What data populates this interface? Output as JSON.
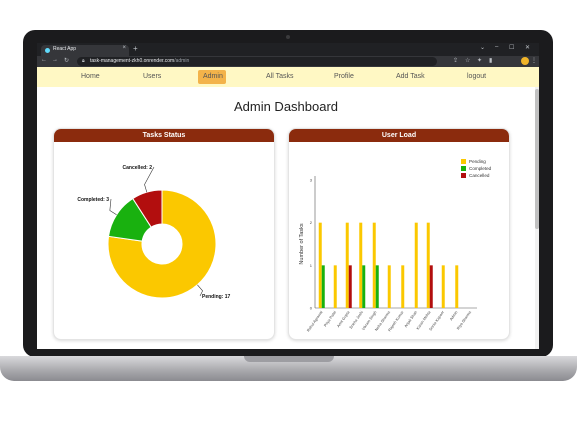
{
  "browser": {
    "tab_title": "React App",
    "tab_close": "×",
    "new_tab": "+",
    "url_host": "task-management-zkh0.onrender.com",
    "url_path": "/admin",
    "icons": [
      "back-arrow-icon",
      "forward-arrow-icon",
      "reload-icon",
      "lock-icon",
      "share-icon",
      "star-icon",
      "extensions-icon",
      "sidebar-icon",
      "profile-avatar",
      "menu-icon"
    ]
  },
  "nav": {
    "items": [
      {
        "label": "Home"
      },
      {
        "label": "Users"
      },
      {
        "label": "Admin",
        "active": true
      },
      {
        "label": "All Tasks"
      },
      {
        "label": "Profile"
      },
      {
        "label": "Add Task"
      },
      {
        "label": "logout"
      }
    ]
  },
  "page": {
    "title": "Admin Dashboard"
  },
  "colors": {
    "header": "#8b2b0d",
    "navbar": "#fff8c4",
    "pending": "#fbc800",
    "completed": "#19b10f",
    "cancelled": "#b20e0e"
  },
  "chart_data": [
    {
      "type": "pie",
      "title": "Tasks Status",
      "donut": true,
      "slices": [
        {
          "label": "Pending",
          "value": 17,
          "color": "#fbc800",
          "text": "Pending: 17"
        },
        {
          "label": "Completed",
          "value": 3,
          "color": "#19b10f",
          "text": "Completed: 3"
        },
        {
          "label": "Cancelled",
          "value": 2,
          "color": "#b20e0e",
          "text": "Cancelled: 2"
        }
      ]
    },
    {
      "type": "bar",
      "title": "User Load",
      "ylabel": "Number of Tasks",
      "ylim": [
        0,
        3
      ],
      "yticks": [
        "3",
        "2",
        "1",
        "0"
      ],
      "legend_position": "top-right",
      "categories": [
        "Rahul Agrawal",
        "Priya Patel",
        "Amit Gupta",
        "Sneha Joshi",
        "Vikram Singh",
        "Neha Sharma",
        "Rajesh Kumar",
        "Anjali Shah",
        "Karan Mehta",
        "Sonia Kapoor",
        "Admin",
        "Riya Sharma"
      ],
      "series": [
        {
          "name": "Pending",
          "color": "#fbc800",
          "values": [
            2,
            1,
            2,
            2,
            2,
            1,
            1,
            2,
            2,
            1,
            1,
            0
          ]
        },
        {
          "name": "Completed",
          "color": "#19b10f",
          "values": [
            1,
            0,
            0,
            1,
            1,
            0,
            0,
            0,
            0,
            0,
            0,
            0
          ]
        },
        {
          "name": "Cancelled",
          "color": "#b20e0e",
          "values": [
            0,
            0,
            1,
            0,
            0,
            0,
            0,
            0,
            1,
            0,
            0,
            0
          ]
        }
      ]
    }
  ]
}
